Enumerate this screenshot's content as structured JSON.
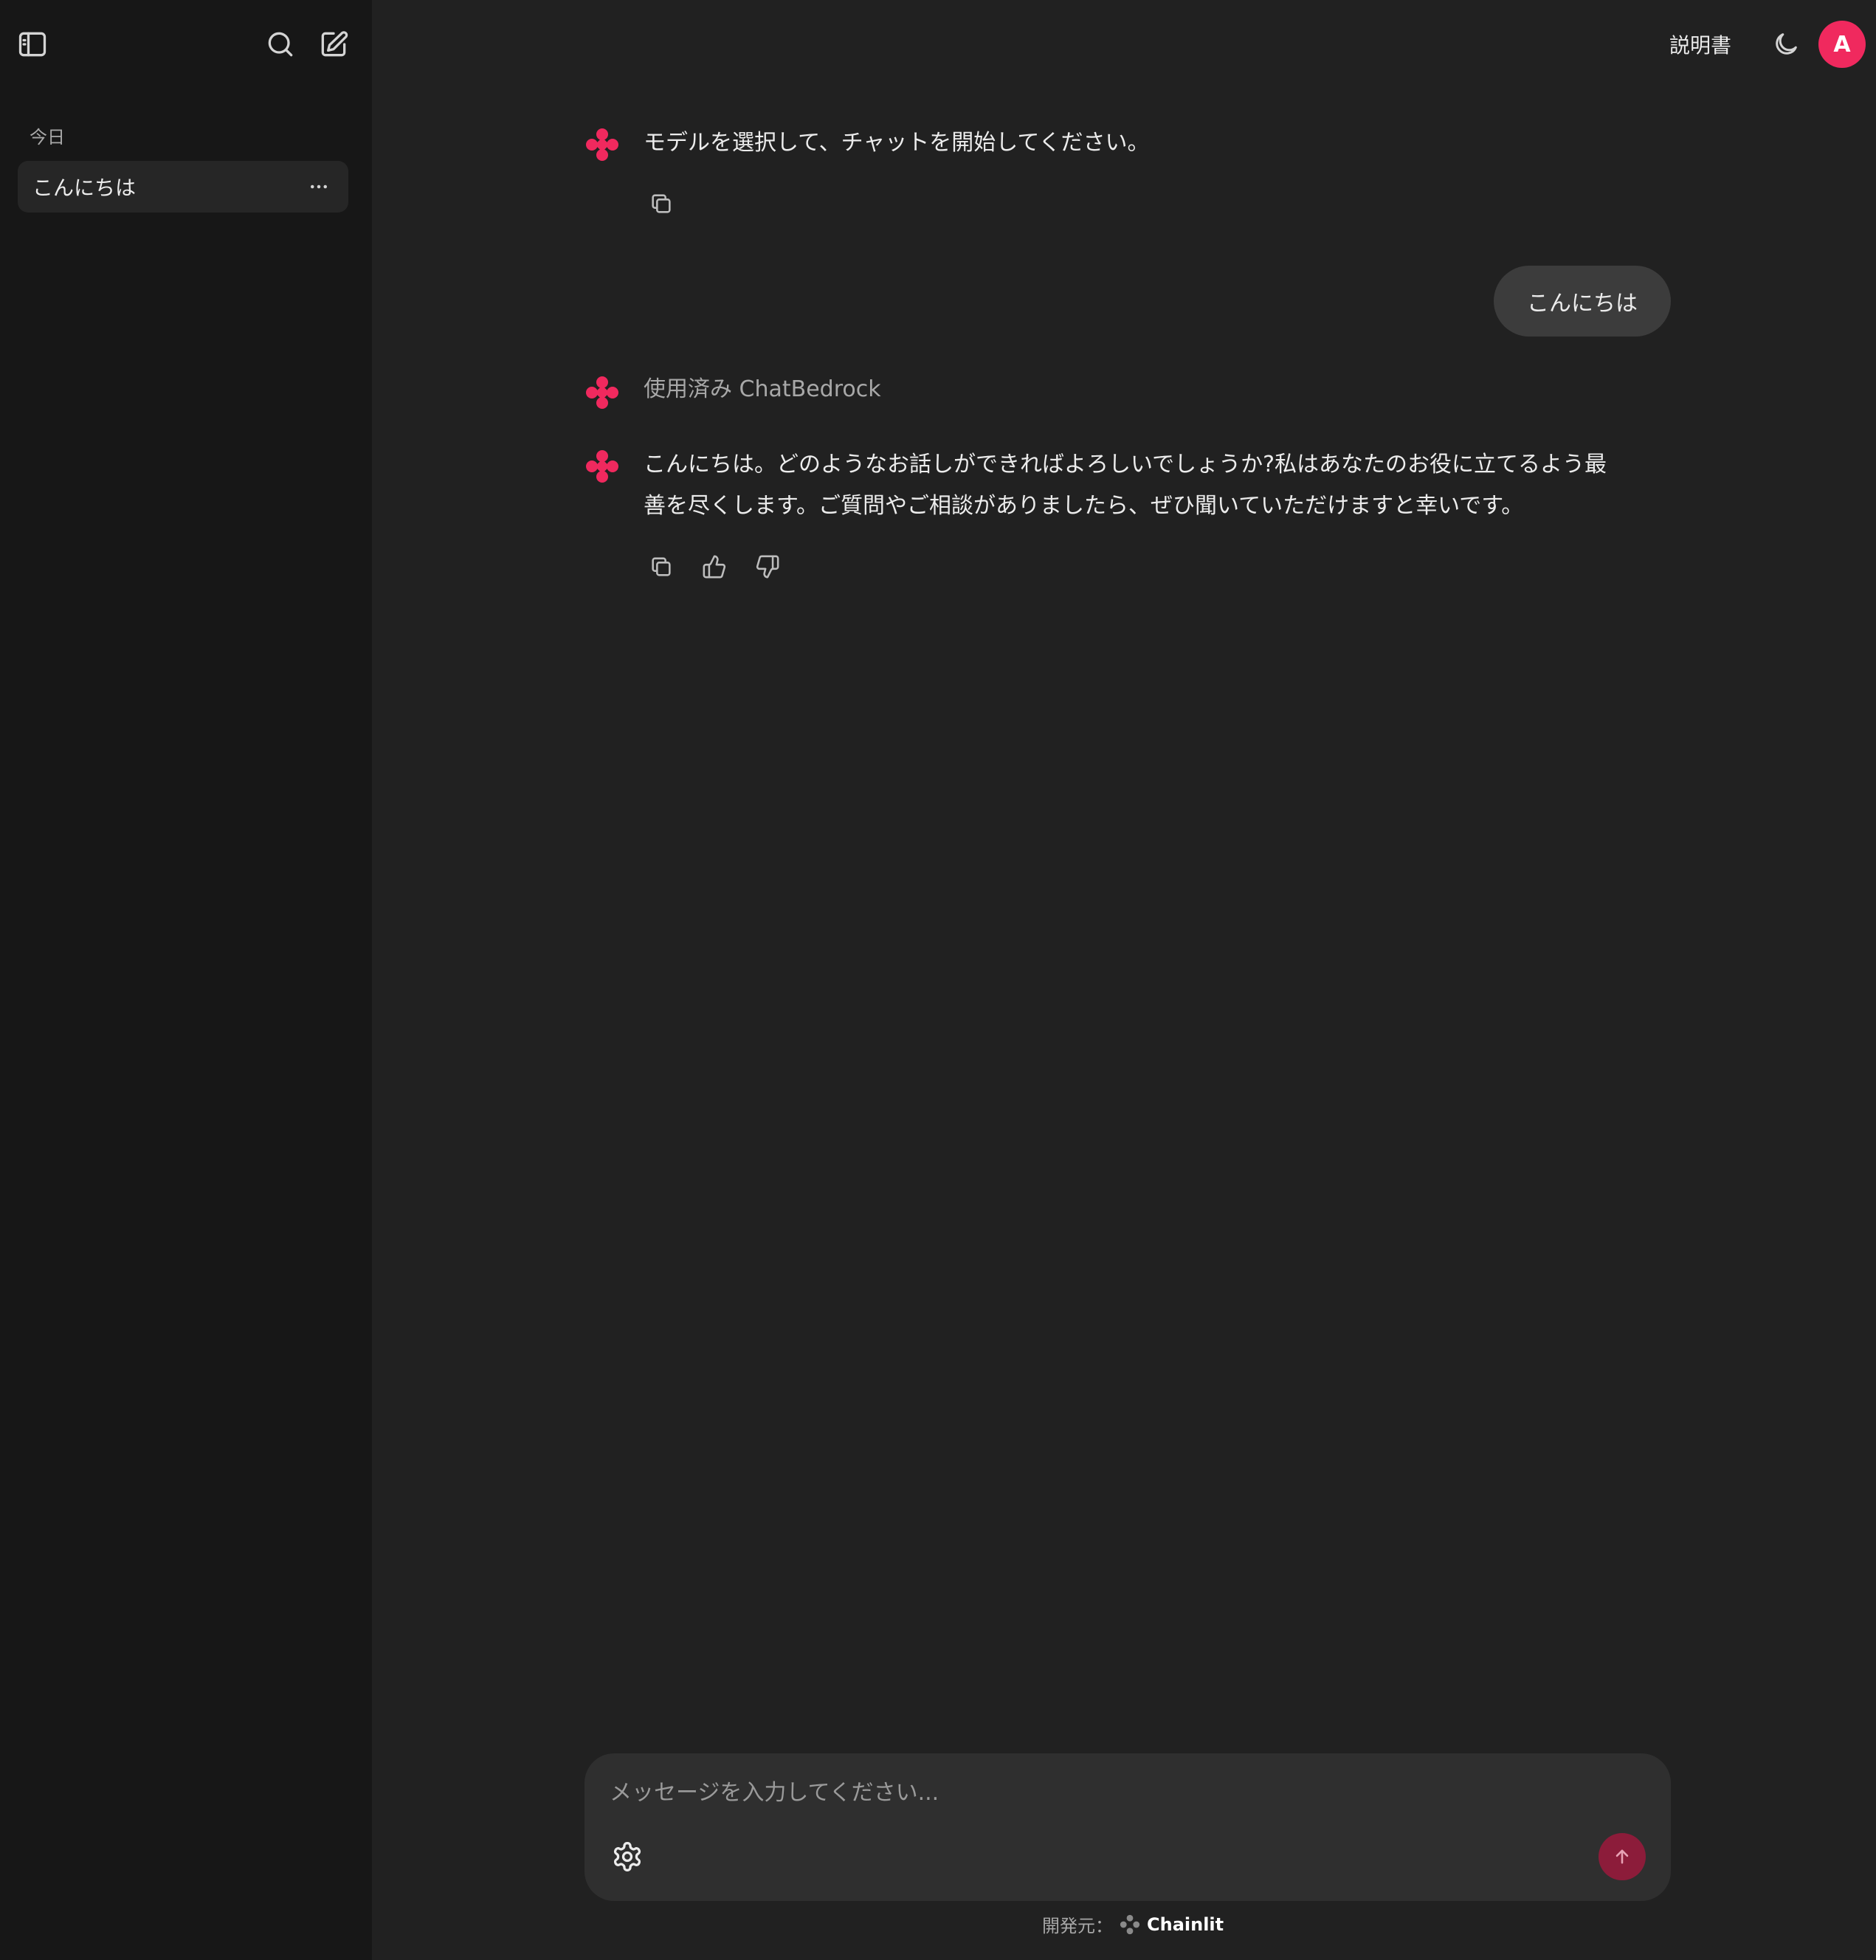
{
  "sidebar": {
    "section_label": "今日",
    "items": [
      {
        "label": "こんにちは"
      }
    ],
    "icons": [
      "sidebar-toggle-icon",
      "search-icon",
      "new-chat-icon"
    ]
  },
  "header": {
    "readme_label": "説明書",
    "avatar_initial": "A",
    "avatar_color": "#f0295e"
  },
  "messages": [
    {
      "role": "assistant",
      "text": "モデルを選択して、チャットを開始してください。"
    },
    {
      "role": "user",
      "text": "こんにちは"
    },
    {
      "role": "step",
      "text": "使用済み ChatBedrock"
    },
    {
      "role": "assistant",
      "lines": [
        "こんにちは。どのようなお話しができればよろしいでしょうか?私はあなたのお役に立てるよう最",
        "善を尽くします。ご質問やご相談がありましたら、ぜひ聞いていただけますと幸いです。"
      ]
    }
  ],
  "composer": {
    "placeholder": "メッセージを入力してください..."
  },
  "footer": {
    "prefix": "開発元：",
    "brand": "Chainlit"
  },
  "colors": {
    "accent": "#f0295e",
    "send_button": "#8c1c3a",
    "background": "#212121",
    "sidebar": "#171717"
  }
}
